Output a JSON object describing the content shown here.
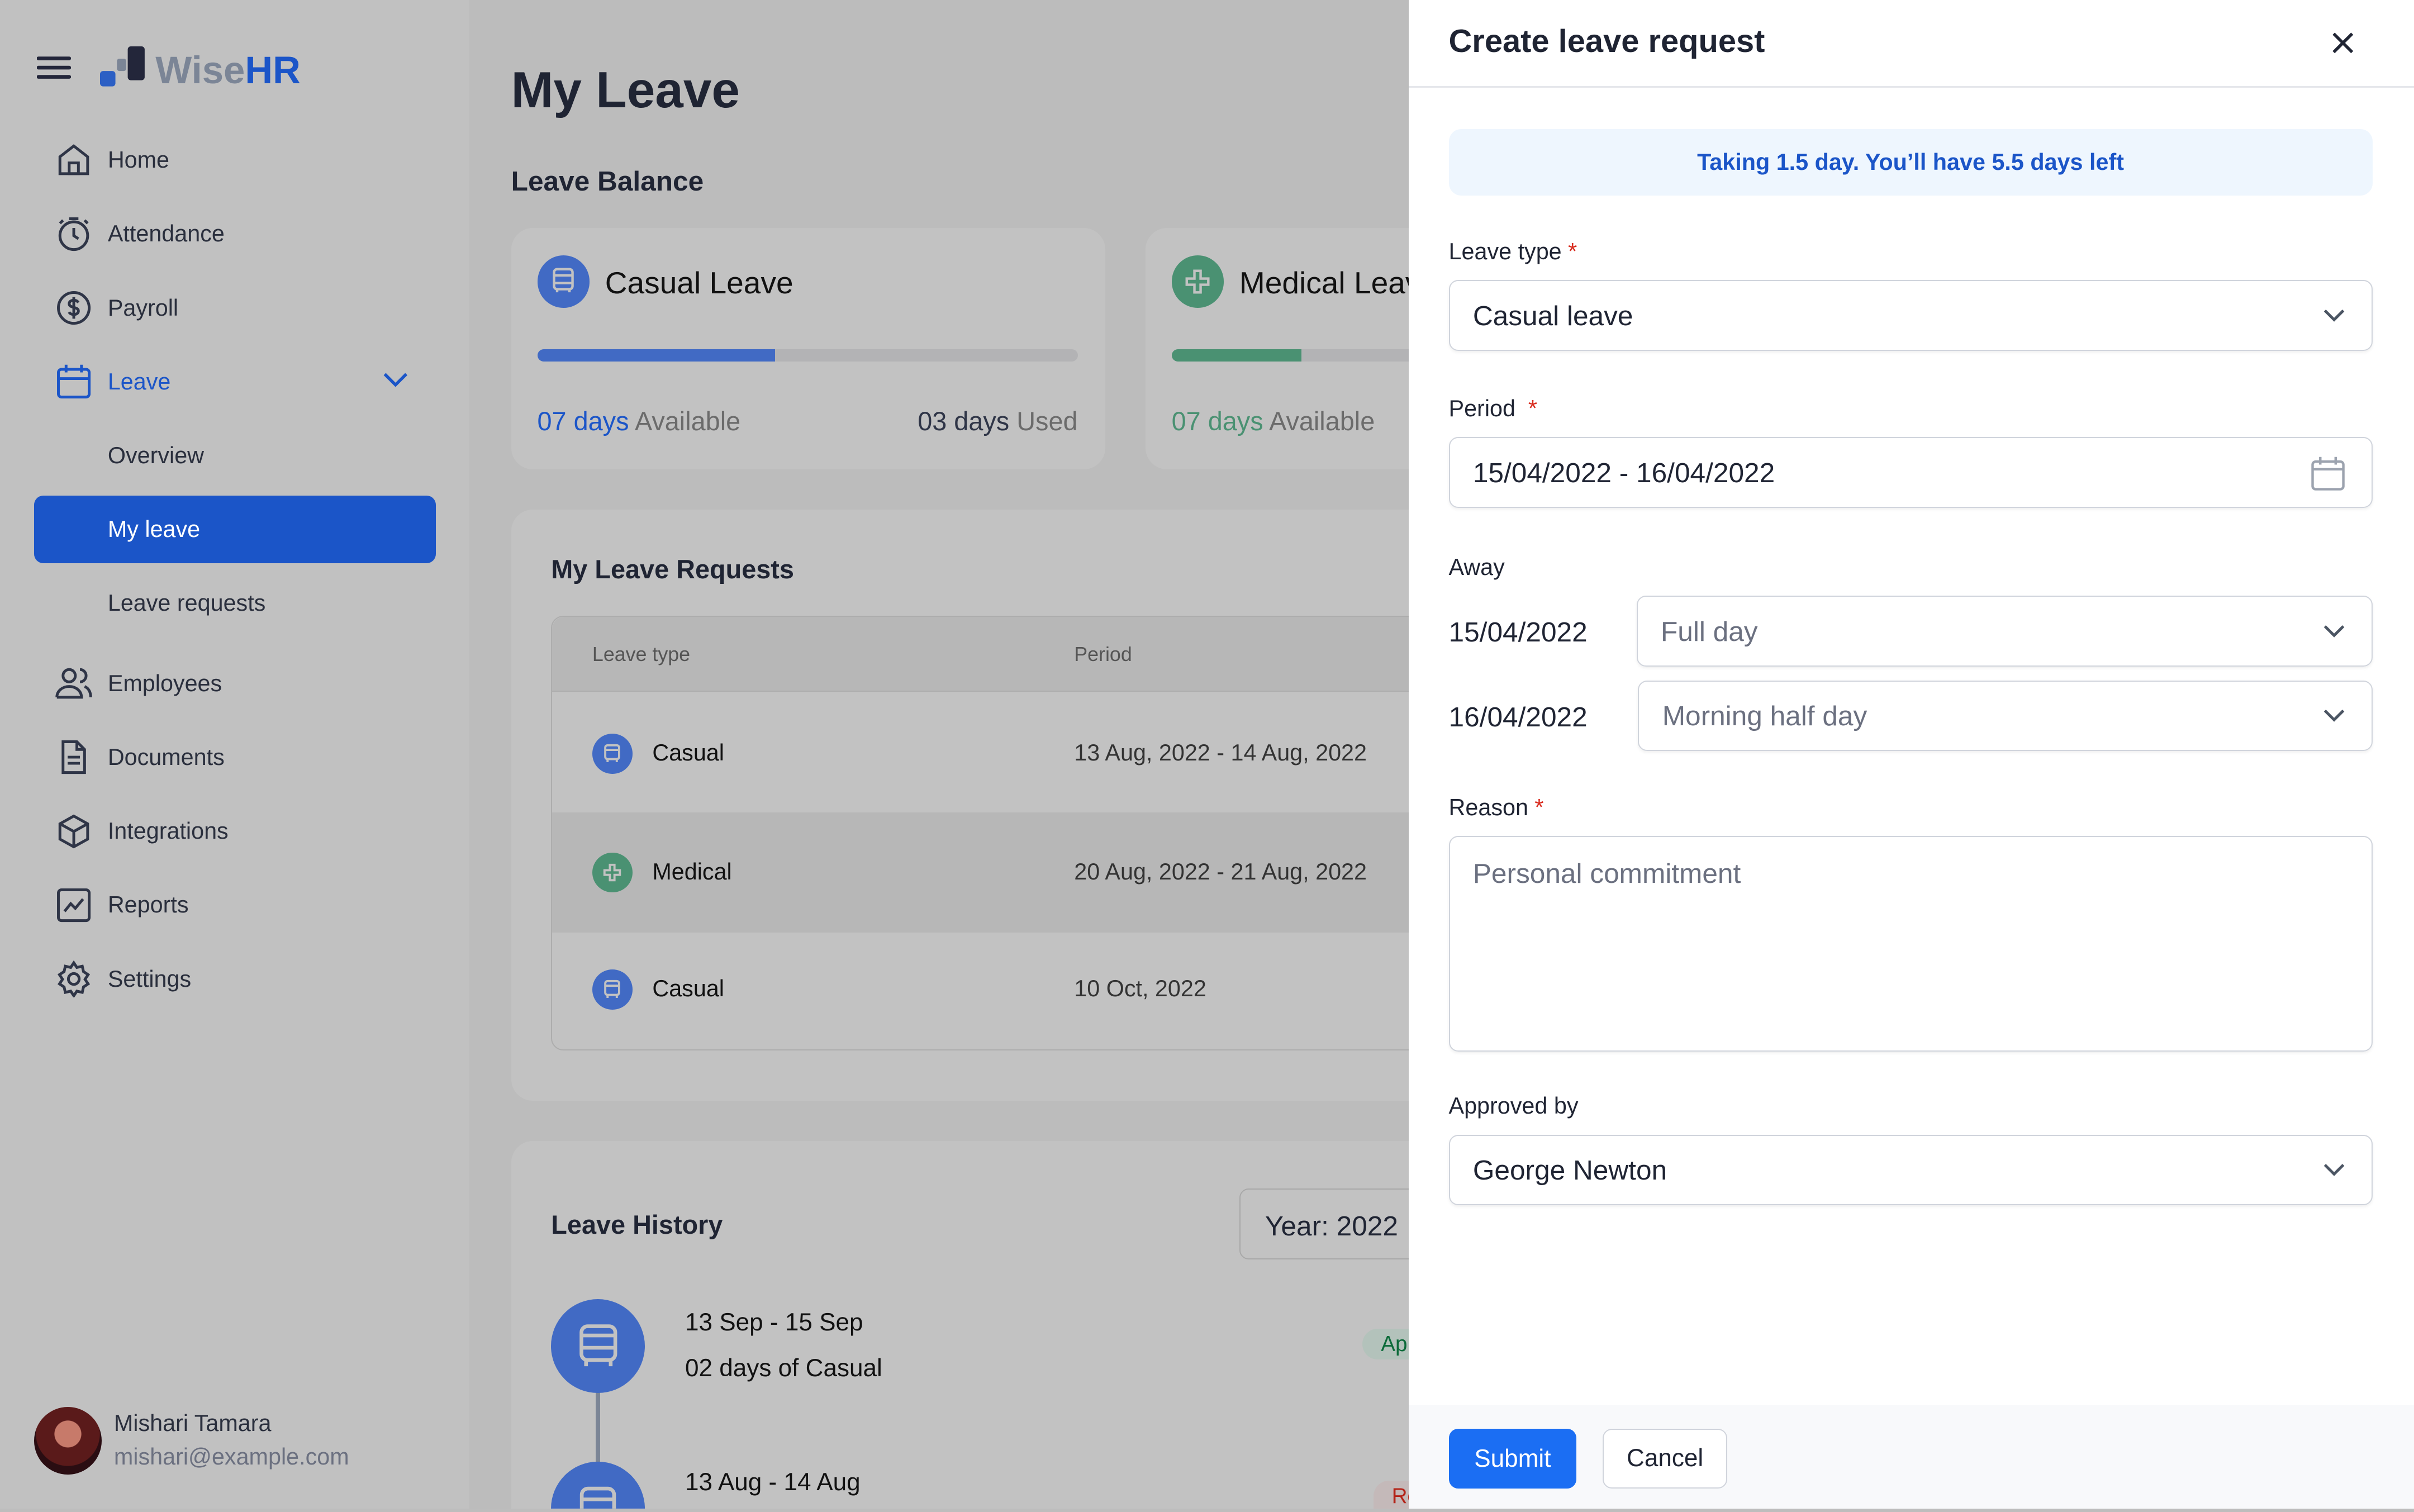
{
  "brand": {
    "name_part1": "Wise",
    "name_part2": "HR"
  },
  "sidebar": {
    "items": [
      {
        "label": "Home",
        "icon": "home-icon"
      },
      {
        "label": "Attendance",
        "icon": "stopwatch-icon"
      },
      {
        "label": "Payroll",
        "icon": "dollar-icon"
      },
      {
        "label": "Leave",
        "icon": "calendar-icon"
      },
      {
        "label": "Overview"
      },
      {
        "label": "My leave"
      },
      {
        "label": "Leave requests"
      },
      {
        "label": "Employees",
        "icon": "users-icon"
      },
      {
        "label": "Documents",
        "icon": "document-icon"
      },
      {
        "label": "Integrations",
        "icon": "cube-icon"
      },
      {
        "label": "Reports",
        "icon": "chart-icon"
      },
      {
        "label": "Settings",
        "icon": "gear-icon"
      }
    ],
    "user": {
      "name": "Mishari Tamara",
      "email": "mishari@example.com"
    }
  },
  "main": {
    "title": "My Leave",
    "balance_heading": "Leave Balance",
    "balances": [
      {
        "name": "Casual Leave",
        "available_num": "07 days",
        "available_word": "Available",
        "used_num": "03 days",
        "used_word": "Used",
        "fill": 0.44,
        "color": "#416ac4"
      },
      {
        "name": "Medical Leave",
        "available_num": "07 days",
        "available_word": "Available",
        "fill": 0.24,
        "color": "#4a9172"
      }
    ],
    "requests_heading": "My Leave Requests",
    "columns": [
      "Leave type",
      "Period"
    ],
    "rows": [
      {
        "type": "Casual",
        "period": "13 Aug, 2022 - 14 Aug, 2022"
      },
      {
        "type": "Medical",
        "period": "20 Aug, 2022 - 21 Aug, 2022"
      },
      {
        "type": "Casual",
        "period": "10 Oct, 2022"
      }
    ],
    "history_heading": "Leave History",
    "year_select": "Year: 2022",
    "history": [
      {
        "dates": "13 Sep - 15 Sep",
        "desc": "02 days of Casual",
        "status": "Approved"
      },
      {
        "dates": "13 Aug - 14 Aug",
        "status": "Rejected"
      }
    ]
  },
  "panel": {
    "title": "Create leave request",
    "info": "Taking 1.5 day. You’ll have 5.5 days left",
    "leave_type_label": "Leave type",
    "leave_type_value": "Casual leave",
    "period_label": "Period",
    "period_value": "15/04/2022 - 16/04/2022",
    "away_label": "Away",
    "away": [
      {
        "date": "15/04/2022",
        "value": "Full day"
      },
      {
        "date": "16/04/2022",
        "value": "Morning half day"
      }
    ],
    "reason_label": "Reason",
    "reason_placeholder": "Personal commitment",
    "approved_label": "Approved by",
    "approved_value": "George Newton",
    "submit": "Submit",
    "cancel": "Cancel",
    "required_mark": "*"
  }
}
